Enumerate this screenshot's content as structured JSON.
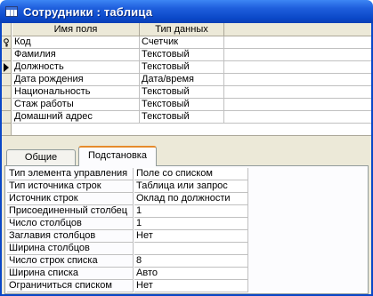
{
  "window": {
    "title": "Сотрудники : таблица"
  },
  "grid": {
    "headers": [
      "Имя поля",
      "Тип данных"
    ],
    "rows": [
      {
        "name": "Код",
        "type": "Счетчик",
        "primary_key": true
      },
      {
        "name": "Фамилия",
        "type": "Текстовый"
      },
      {
        "name": "Должность",
        "type": "Текстовый",
        "current": true
      },
      {
        "name": "Дата рождения",
        "type": "Дата/время"
      },
      {
        "name": "Национальность",
        "type": "Текстовый"
      },
      {
        "name": "Стаж работы",
        "type": "Текстовый"
      },
      {
        "name": "Домашний адрес",
        "type": "Текстовый"
      }
    ]
  },
  "tabs": [
    {
      "label": "Общие",
      "active": false
    },
    {
      "label": "Подстановка",
      "active": true
    }
  ],
  "properties": [
    {
      "label": "Тип элемента управления",
      "value": "Поле со списком"
    },
    {
      "label": "Тип источника строк",
      "value": "Таблица или запрос"
    },
    {
      "label": "Источник строк",
      "value": "Оклад по должности"
    },
    {
      "label": "Присоединенный столбец",
      "value": "1"
    },
    {
      "label": "Число столбцов",
      "value": "1"
    },
    {
      "label": "Заглавия столбцов",
      "value": "Нет"
    },
    {
      "label": "Ширина столбцов",
      "value": ""
    },
    {
      "label": "Число строк списка",
      "value": "8"
    },
    {
      "label": "Ширина списка",
      "value": "Авто"
    },
    {
      "label": "Ограничиться списком",
      "value": "Нет"
    }
  ],
  "icons": {
    "title": "table-icon",
    "key": "primary-key-icon",
    "current_row": "current-row-arrow-icon"
  }
}
